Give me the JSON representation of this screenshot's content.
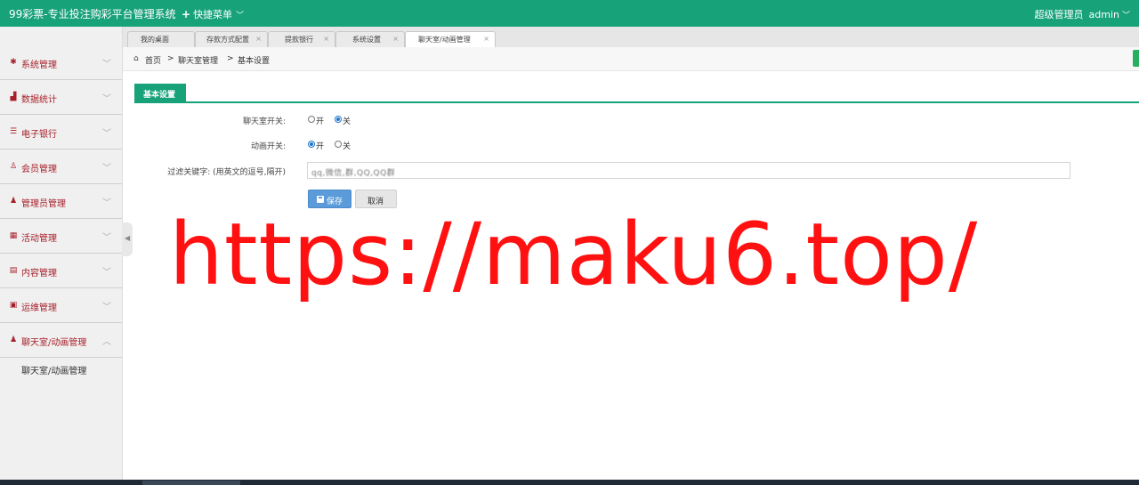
{
  "header": {
    "app_title": "99彩票-专业投注购彩平台管理系统",
    "quick_menu_label": "快捷菜单",
    "role_label": "超级管理员",
    "username": "admin"
  },
  "sidebar": {
    "items": [
      {
        "label": "系统管理",
        "icon": "gear-icon"
      },
      {
        "label": "数据统计",
        "icon": "chart-icon"
      },
      {
        "label": "电子银行",
        "icon": "list-icon"
      },
      {
        "label": "会员管理",
        "icon": "user-icon"
      },
      {
        "label": "管理员管理",
        "icon": "admin-icon"
      },
      {
        "label": "活动管理",
        "icon": "calendar-icon"
      },
      {
        "label": "内容管理",
        "icon": "content-icon"
      },
      {
        "label": "运维管理",
        "icon": "ops-icon"
      },
      {
        "label": "聊天室/动画管理",
        "icon": "chat-user-icon"
      }
    ],
    "sub_item": "聊天室/动画管理"
  },
  "tabs": [
    {
      "label": "我的桌面",
      "closable": false
    },
    {
      "label": "存款方式配置",
      "closable": true
    },
    {
      "label": "提款银行",
      "closable": true
    },
    {
      "label": "系统设置",
      "closable": true
    },
    {
      "label": "聊天室/动画管理",
      "closable": true,
      "active": true
    }
  ],
  "breadcrumb": {
    "home": "首页",
    "sep": ">",
    "level1": "聊天室管理",
    "level2": "基本设置"
  },
  "section": {
    "title": "基本设置"
  },
  "form": {
    "chat_switch_label": "聊天室开关:",
    "anim_switch_label": "动画开关:",
    "on_label": "开",
    "off_label": "关",
    "chat_switch_value": "关",
    "anim_switch_value": "开",
    "keyword_label": "过滤关键字: (用英文的逗号,隔开)",
    "keyword_value": "qq,微信,群,QQ,QQ群",
    "save_label": "保存",
    "cancel_label": "取消"
  },
  "watermark": "https://maku6.top/",
  "colors": {
    "header_green": "#18a27a",
    "sidebar_text": "#a6202a",
    "save_blue": "#5b9bd9",
    "watermark_red": "#ff1111"
  }
}
